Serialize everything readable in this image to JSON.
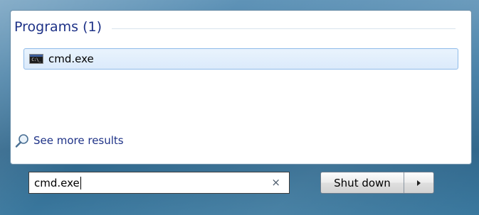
{
  "results": {
    "group_title": "Programs (1)",
    "items": [
      {
        "label": "cmd.exe",
        "icon": "cmd-icon",
        "icon_text": "C:\\_"
      }
    ],
    "see_more_label": "See more results",
    "see_more_icon": "magnifier-icon"
  },
  "search": {
    "value": "cmd.exe",
    "clear_icon": "×"
  },
  "power": {
    "shutdown_label": "Shut down",
    "options_icon": "triangle-right-icon"
  },
  "colors": {
    "frame": "#3f7aa2",
    "link": "#1e3287",
    "selection": "#dbeafb",
    "selection_border": "#8fbbe9"
  }
}
